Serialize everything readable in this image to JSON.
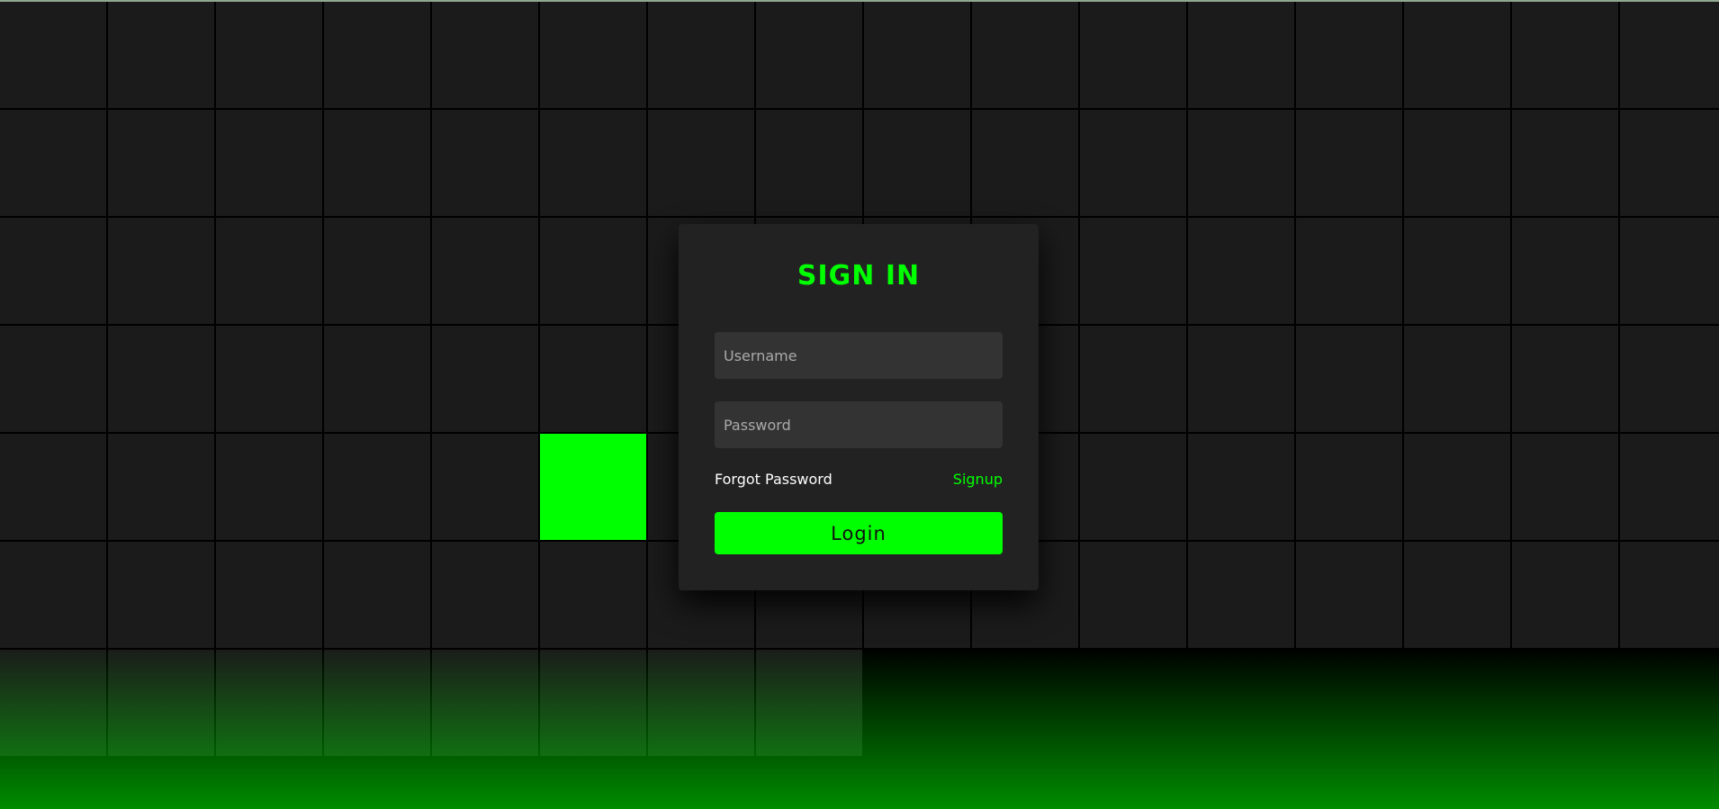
{
  "theme": {
    "accent": "#00ff00",
    "background": "#1b1b1b",
    "card": "#222222",
    "input": "#333333",
    "gridline": "#000000"
  },
  "signin": {
    "title": "SIGN IN",
    "username_placeholder": "Username",
    "password_placeholder": "Password",
    "forgot_label": "Forgot Password",
    "signup_label": "Signup",
    "login_label": "Login"
  }
}
